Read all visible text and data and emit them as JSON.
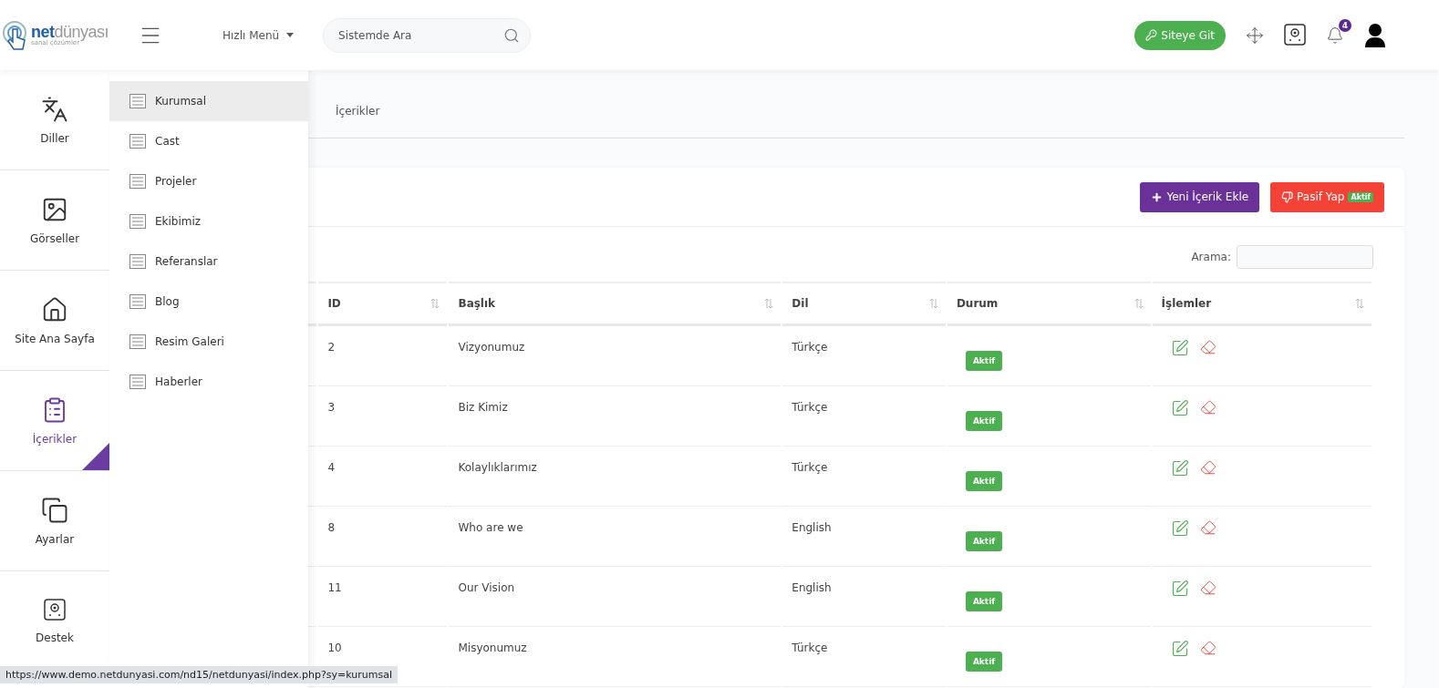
{
  "header": {
    "logo": {
      "name": "**net**dünyası",
      "tagline": "sanal çözümler"
    },
    "quick_menu": "Hızlı Menü",
    "search": {
      "placeholder": "Sistemde Ara"
    },
    "site_button": "Siteye Git",
    "notifications": "4"
  },
  "sidebar": {
    "items": [
      {
        "label": "Diller",
        "selected": false
      },
      {
        "label": "Görseller",
        "selected": false
      },
      {
        "label": "Site Ana Sayfa",
        "selected": false
      },
      {
        "label": "İçerikler",
        "selected": true
      },
      {
        "label": "Ayarlar",
        "selected": false
      },
      {
        "label": "Destek",
        "selected": false
      }
    ]
  },
  "submenu": {
    "items": [
      {
        "label": "Kurumsal",
        "selected": true
      },
      {
        "label": "Cast",
        "selected": false
      },
      {
        "label": "Projeler",
        "selected": false
      },
      {
        "label": "Ekibimiz",
        "selected": false
      },
      {
        "label": "Referanslar",
        "selected": false
      },
      {
        "label": "Blog",
        "selected": false
      },
      {
        "label": "Resim Galeri",
        "selected": false
      },
      {
        "label": "Haberler",
        "selected": false
      }
    ]
  },
  "breadcrumb": "İçerikler",
  "card": {
    "add_button": "Yeni İçerik Ekle",
    "passive_button": "Pasif Yap",
    "passive_badge": "Aktif",
    "search_label": "Arama:"
  },
  "table": {
    "columns": [
      "ID",
      "Başlık",
      "Dil",
      "Durum",
      "İşlemler"
    ],
    "rows": [
      {
        "id": "2",
        "title": "Vizyonumuz",
        "language": "Türkçe",
        "status": "Aktif"
      },
      {
        "id": "3",
        "title": "Biz Kimiz",
        "language": "Türkçe",
        "status": "Aktif"
      },
      {
        "id": "4",
        "title": "Kolaylıklarımız",
        "language": "Türkçe",
        "status": "Aktif"
      },
      {
        "id": "8",
        "title": "Who are we",
        "language": "English",
        "status": "Aktif"
      },
      {
        "id": "11",
        "title": "Our Vision",
        "language": "English",
        "status": "Aktif"
      },
      {
        "id": "10",
        "title": "Misyonumuz",
        "language": "Türkçe",
        "status": "Aktif"
      }
    ]
  },
  "status_bar": "https://www.demo.netdunyasi.com/nd15/netdunyasi/index.php?sy=kurumsal"
}
